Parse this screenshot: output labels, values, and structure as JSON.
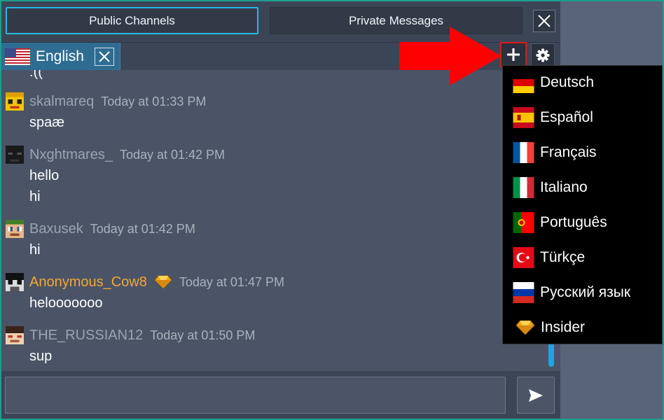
{
  "tabs": {
    "public_label": "Public Channels",
    "private_label": "Private Messages"
  },
  "channel": {
    "label": "English"
  },
  "messages": [
    {
      "text": ":(("
    },
    {
      "user": "skalmareq",
      "time": "Today at 01:33 PM",
      "lines": [
        "spaæ"
      ]
    },
    {
      "user": "Nxghtmares_",
      "time": "Today at 01:42 PM",
      "lines": [
        "hello",
        "hi"
      ]
    },
    {
      "user": "Baxusek",
      "time": "Today at 01:42 PM",
      "lines": [
        "hi"
      ]
    },
    {
      "user": "Anonymous_Cow8",
      "time": "Today at 01:47 PM",
      "lines": [
        "helooooooo"
      ]
    },
    {
      "user": "THE_RUSSIAN12",
      "time": "Today at 01:50 PM",
      "lines": [
        "sup"
      ]
    }
  ],
  "language_menu": [
    {
      "label": "Deutsch"
    },
    {
      "label": "Español"
    },
    {
      "label": "Français"
    },
    {
      "label": "Italiano"
    },
    {
      "label": "Português"
    },
    {
      "label": "Türkçe"
    },
    {
      "label": "Русский язык"
    },
    {
      "label": "Insider"
    }
  ],
  "input": {
    "value": "",
    "placeholder": ""
  },
  "icons": {
    "close": "close-icon",
    "add": "plus-icon",
    "settings": "gear-icon",
    "send": "send-icon",
    "insider_badge": "gem-icon"
  },
  "colors": {
    "accent": "#29b6e3",
    "active_channel": "#2f6c92",
    "highlight_arrow": "#ff0000",
    "insider_name": "#f7a532"
  }
}
